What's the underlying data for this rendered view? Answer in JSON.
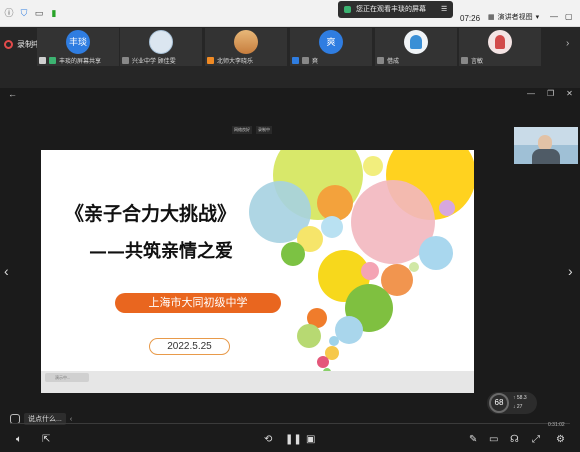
{
  "topbar": {
    "share_notice": "您正在观看丰琰的屏幕",
    "share_menu": "☰",
    "time": "07:26",
    "layout_label": "演讲者视图",
    "status_icons": [
      "info-icon",
      "shield-icon",
      "battery-icon",
      "signal-icon"
    ]
  },
  "strip": {
    "recording_label": "录制中",
    "participants": [
      {
        "name": "丰琰的屏幕共享",
        "avatar_text": "丰琰",
        "color": "#2f7de1"
      },
      {
        "name": "兴业中学 顾佳雯",
        "avatar_text": "",
        "color": "#e0e7ef"
      },
      {
        "name": "北师大李晓乐",
        "avatar_text": "",
        "color": "#d9a46a"
      },
      {
        "name": "爽",
        "avatar_text": "爽",
        "color": "#2f7de1"
      },
      {
        "name": "借成",
        "avatar_text": "",
        "color": "#e9eef2"
      },
      {
        "name": "言敏",
        "avatar_text": "",
        "color": "#f0e1e1"
      }
    ]
  },
  "main": {
    "small_badges": [
      "网络良好",
      "录制中"
    ]
  },
  "slide": {
    "title_line1": "《亲子合力大挑战》",
    "title_line2": "——共筑亲情之爱",
    "school": "上海市大同初级中学",
    "date": "2022.5.25",
    "footer_chip": "演示中..."
  },
  "bottom": {
    "chat_text": "说点什么...",
    "net_quality": "68",
    "upload": "58.3",
    "download": "27",
    "duration": "0:31:02"
  }
}
